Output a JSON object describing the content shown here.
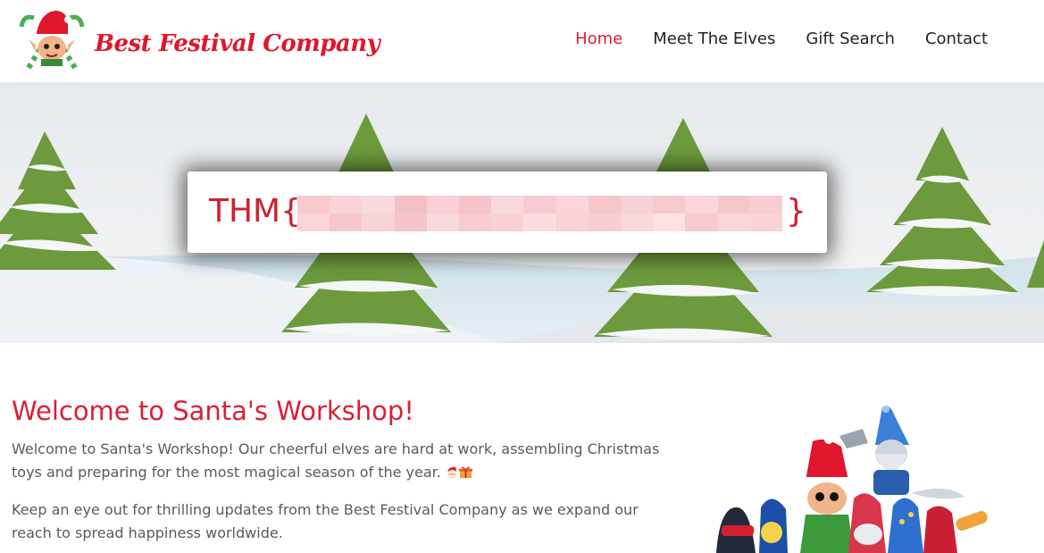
{
  "brand": {
    "name": "Best Festival Company"
  },
  "nav": {
    "items": [
      {
        "label": "Home",
        "active": true
      },
      {
        "label": "Meet The Elves",
        "active": false
      },
      {
        "label": "Gift Search",
        "active": false
      },
      {
        "label": "Contact",
        "active": false
      }
    ]
  },
  "hero": {
    "flag_prefix": "THM{",
    "flag_suffix": "}",
    "flag_value_state": "blurred"
  },
  "main": {
    "title": "Welcome to Santa's Workshop!",
    "paragraph_1": "Welcome to Santa's Workshop! Our cheerful elves are hard at work, assembling Christmas toys and preparing for the most magical season of the year.",
    "paragraph_2": "Keep an eye out for thrilling updates from the Best Festival Company as we expand our reach to spread happiness worldwide."
  },
  "colors": {
    "accent": "#dc1e35",
    "nav_text": "#222222",
    "body_text": "#5a5a5a",
    "tree_green": "#6c9a3c"
  },
  "icons": [
    "elf-logo-icon",
    "santa-emoji-icon",
    "gift-emoji-icon"
  ]
}
